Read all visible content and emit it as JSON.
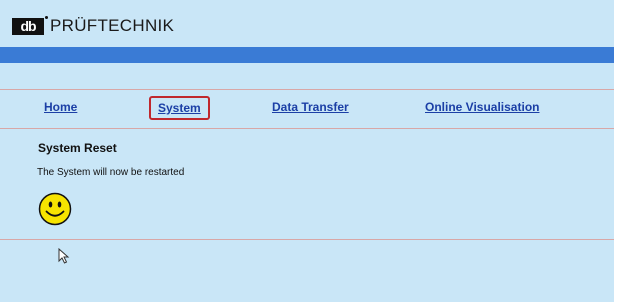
{
  "header": {
    "logo_mark": "db",
    "logo_text": "PRÜFTECHNIK"
  },
  "nav": {
    "items": [
      {
        "label": "Home"
      },
      {
        "label": "System",
        "selected": true
      },
      {
        "label": "Data Transfer"
      },
      {
        "label": "Online Visualisation"
      }
    ]
  },
  "main": {
    "section_title": "System Reset",
    "message": "The System will now be restarted",
    "status_icon": "smiley-face-icon"
  },
  "colors": {
    "page_background": "#c9e6f7",
    "header_band": "#3a7bd5",
    "link": "#1b3fa6",
    "selected_outline": "#c0282d",
    "divider": "#d8a7a7",
    "smiley_fill": "#f7e400"
  }
}
